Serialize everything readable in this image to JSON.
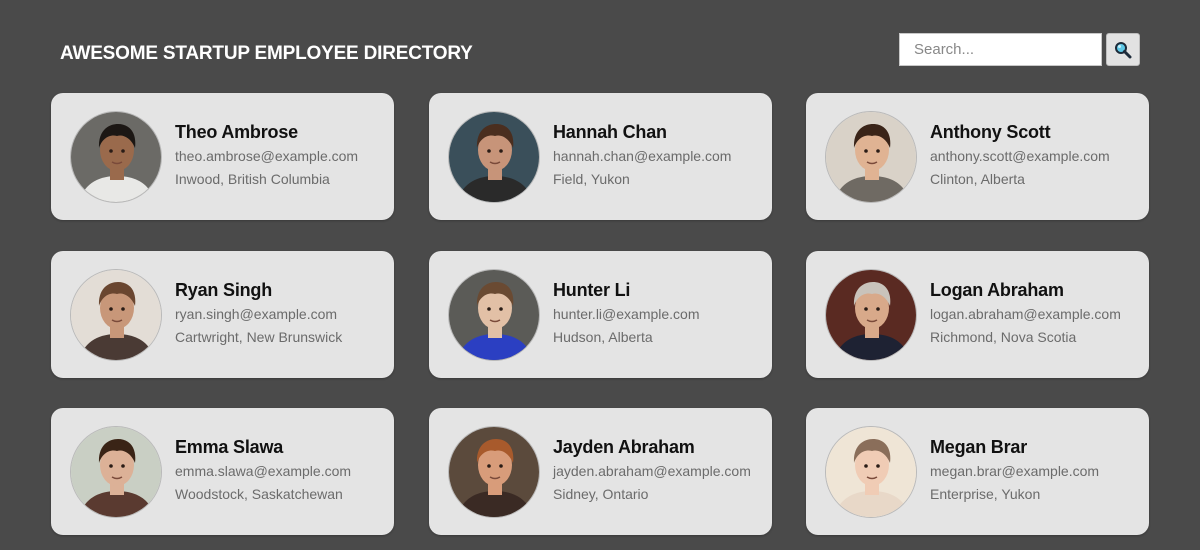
{
  "header": {
    "title": "AWESOME STARTUP EMPLOYEE DIRECTORY",
    "search_placeholder": "Search...",
    "search_icon": "magnifier-icon"
  },
  "employees": [
    {
      "name": "Theo Ambrose",
      "email": "theo.ambrose@example.com",
      "location": "Inwood, British Columbia",
      "colors": {
        "bg": "#6b6a66",
        "skin": "#9a6a4c",
        "hair": "#1c1714",
        "shirt": "#e8e8e6"
      }
    },
    {
      "name": "Hannah Chan",
      "email": "hannah.chan@example.com",
      "location": "Field, Yukon",
      "colors": {
        "bg": "#3a4f5a",
        "skin": "#c79479",
        "hair": "#4a2e1f",
        "shirt": "#2a2a2a"
      }
    },
    {
      "name": "Anthony Scott",
      "email": "anthony.scott@example.com",
      "location": "Clinton, Alberta",
      "colors": {
        "bg": "#d9d2c8",
        "skin": "#e0b393",
        "hair": "#3a2418",
        "shirt": "#6f6a63"
      }
    },
    {
      "name": "Ryan Singh",
      "email": "ryan.singh@example.com",
      "location": "Cartwright, New Brunswick",
      "colors": {
        "bg": "#e3ddd6",
        "skin": "#c89779",
        "hair": "#6a4630",
        "shirt": "#4a3a34"
      }
    },
    {
      "name": "Hunter Li",
      "email": "hunter.li@example.com",
      "location": "Hudson, Alberta",
      "colors": {
        "bg": "#5b5b57",
        "skin": "#e2c0a6",
        "hair": "#6a4a32",
        "shirt": "#2b3fc2"
      }
    },
    {
      "name": "Logan Abraham",
      "email": "logan.abraham@example.com",
      "location": "Richmond, Nova Scotia",
      "colors": {
        "bg": "#5a2a22",
        "skin": "#d8a98a",
        "hair": "#c9c3bb",
        "shirt": "#1e2233"
      }
    },
    {
      "name": "Emma Slawa",
      "email": "emma.slawa@example.com",
      "location": "Woodstock, Saskatchewan",
      "colors": {
        "bg": "#c9cfc4",
        "skin": "#dcb197",
        "hair": "#3a2416",
        "shirt": "#5a3a30"
      }
    },
    {
      "name": "Jayden Abraham",
      "email": "jayden.abraham@example.com",
      "location": "Sidney, Ontario",
      "colors": {
        "bg": "#5b4a3c",
        "skin": "#d89c7a",
        "hair": "#a85a2c",
        "shirt": "#3a2a24"
      }
    },
    {
      "name": "Megan Brar",
      "email": "megan.brar@example.com",
      "location": "Enterprise, Yukon",
      "colors": {
        "bg": "#efe5d6",
        "skin": "#f0ccb5",
        "hair": "#8a6e5a",
        "shirt": "#e8d8c8"
      }
    }
  ]
}
